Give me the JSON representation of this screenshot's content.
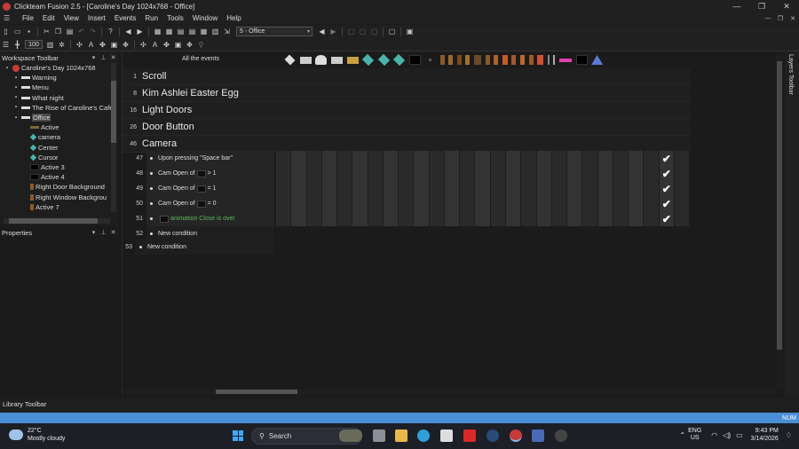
{
  "window": {
    "title": "Clickteam Fusion 2.5 - [Caroline's Day 1024x768 - Office]"
  },
  "menu": [
    "File",
    "Edit",
    "View",
    "Insert",
    "Events",
    "Run",
    "Tools",
    "Window",
    "Help"
  ],
  "toolbar": {
    "frame_select": "5 - Office",
    "zoom": "100"
  },
  "workspace": {
    "title": "Workspace Toolbar",
    "tree": [
      {
        "label": "Caroline's Day 1024x768",
        "level": 0,
        "expander": "-",
        "icon": "app-icon"
      },
      {
        "label": "Warning",
        "level": 1,
        "expander": "+",
        "icon": "frame-icon"
      },
      {
        "label": "Menu",
        "level": 1,
        "expander": "+",
        "icon": "frame-icon"
      },
      {
        "label": "What night",
        "level": 1,
        "expander": "+",
        "icon": "frame-icon"
      },
      {
        "label": "The Rise of Caroline's Cafe",
        "level": 1,
        "expander": "+",
        "icon": "frame-icon"
      },
      {
        "label": "Office",
        "level": 1,
        "expander": "-",
        "icon": "frame-icon",
        "selected": true
      },
      {
        "label": "Active",
        "level": 2,
        "icon": "active-icon"
      },
      {
        "label": "camera",
        "level": 2,
        "icon": "diamond-icon"
      },
      {
        "label": "Center",
        "level": 2,
        "icon": "diamond-icon"
      },
      {
        "label": "Cursor",
        "level": 2,
        "icon": "diamond-icon"
      },
      {
        "label": "Active 3",
        "level": 2,
        "icon": "black-icon"
      },
      {
        "label": "Active 4",
        "level": 2,
        "icon": "black-icon"
      },
      {
        "label": "Right Door Background",
        "level": 2,
        "icon": "door-icon"
      },
      {
        "label": "Right Window Backgrou",
        "level": 2,
        "icon": "door-icon"
      },
      {
        "label": "Active 7",
        "level": 2,
        "icon": "door-icon"
      }
    ]
  },
  "properties": {
    "title": "Properties"
  },
  "editor": {
    "all_events": "All the events",
    "groups": [
      {
        "num": "1",
        "name": "Scroll"
      },
      {
        "num": "8",
        "name": "Kim Ashlei Easter Egg"
      },
      {
        "num": "16",
        "name": "Light Doors"
      },
      {
        "num": "26",
        "name": "Door Button"
      },
      {
        "num": "46",
        "name": "Camera"
      }
    ],
    "events": [
      {
        "num": "47",
        "pre": "Upon pressing \"Space bar\"",
        "thumb": false,
        "post": "",
        "green": false
      },
      {
        "num": "48",
        "pre": "Cam Open of",
        "thumb": true,
        "post": "> 1",
        "green": false
      },
      {
        "num": "49",
        "pre": "Cam Open of",
        "thumb": true,
        "post": "= 1",
        "green": false
      },
      {
        "num": "50",
        "pre": "Cam Open of",
        "thumb": true,
        "post": "= 0",
        "green": false
      },
      {
        "num": "51",
        "pre": "",
        "thumb": true,
        "post": "animation Close is over",
        "green": true
      }
    ],
    "new_conditions": [
      {
        "num": "52",
        "label": "New condition"
      },
      {
        "num": "53",
        "label": "New condition"
      }
    ]
  },
  "layers_toolbar": "Layers Toolbar",
  "library_toolbar": "Library Toolbar",
  "status": {
    "num": "NUM"
  },
  "taskbar": {
    "weather_temp": "22°C",
    "weather_desc": "Mostly cloudy",
    "search": "Search",
    "lang1": "ENG",
    "lang2": "US",
    "time": "9:43 PM",
    "date": "3/14/2026"
  },
  "colors": {
    "accent": "#4a8fd6",
    "condition_green": "#5cb85c",
    "checkmark": "#ffffff"
  }
}
